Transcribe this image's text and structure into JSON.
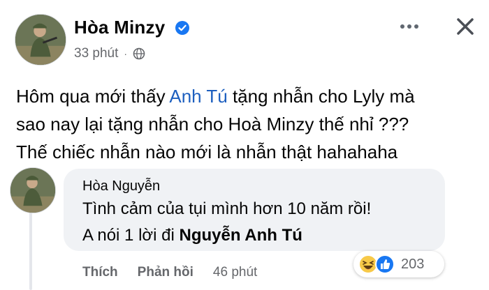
{
  "post": {
    "author": "Hòa Minzy",
    "timestamp": "33 phút",
    "separator": "·",
    "verified": true,
    "text": {
      "line1_before": "Hôm qua mới thấy ",
      "line1_mention": "Anh Tú",
      "line1_after": " tặng nhẫn cho Lyly mà",
      "line2": "sao nay lại tặng nhẫn cho Hoà Minzy thế nhỉ ???",
      "line3": "Thế chiếc nhẫn nào mới là nhẫn thật hahahaha"
    }
  },
  "reply": {
    "author": "Hòa Nguyễn",
    "line1": "Tình cảm của tụi mình hơn 10 năm rồi!",
    "line2_before": "A nói 1 lời đi ",
    "line2_mention": "Nguyễn Anh Tú",
    "actions": {
      "like": "Thích",
      "reply": "Phản hồi",
      "time": "46 phút"
    },
    "reactions": {
      "types": [
        "haha-icon",
        "like-icon"
      ],
      "count": "203"
    }
  },
  "icons": {
    "verified": "verified-badge-icon",
    "globe": "globe-icon",
    "more": "more-options-icon",
    "close": "close-icon"
  },
  "colors": {
    "verified_blue": "#1877f2",
    "mention_blue": "#1d5fbf",
    "secondary_text": "#65676b",
    "bubble_bg": "#f0f2f5"
  }
}
